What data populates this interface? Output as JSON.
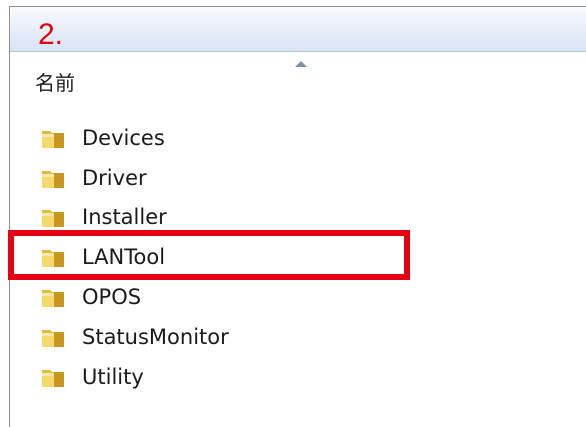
{
  "annotation": {
    "step": "2."
  },
  "list": {
    "column_header": "名前",
    "items": [
      {
        "label": "Devices",
        "icon": "folder-icon"
      },
      {
        "label": "Driver",
        "icon": "folder-icon"
      },
      {
        "label": "Installer",
        "icon": "folder-icon"
      },
      {
        "label": "LANTool",
        "icon": "folder-icon"
      },
      {
        "label": "OPOS",
        "icon": "folder-icon"
      },
      {
        "label": "StatusMonitor",
        "icon": "folder-icon"
      },
      {
        "label": "Utility",
        "icon": "folder-icon"
      }
    ]
  },
  "colors": {
    "highlight": "#e50012",
    "annotation_text": "#e0000d",
    "header_gradient": "#d7e4f4"
  }
}
